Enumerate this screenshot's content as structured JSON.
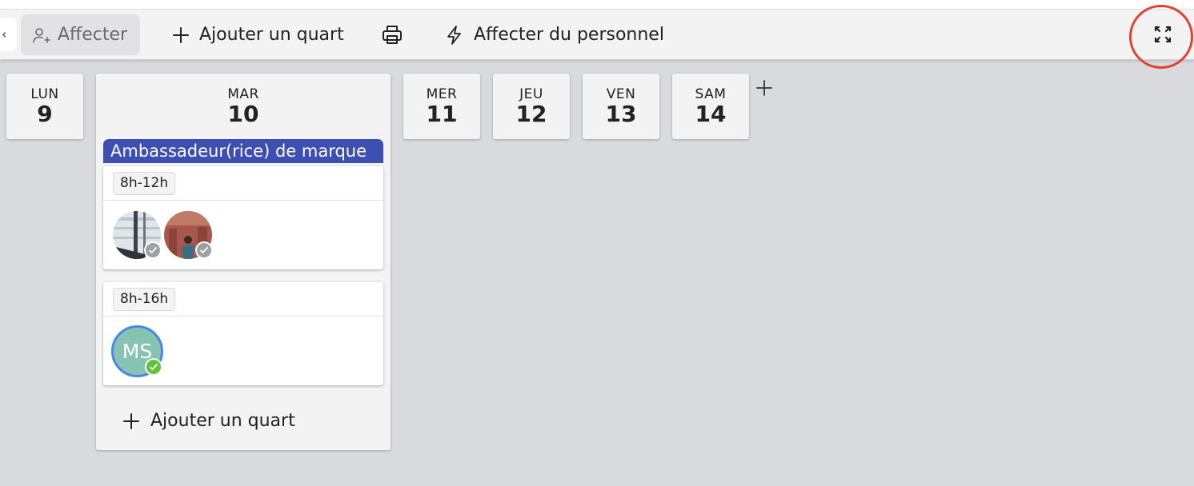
{
  "toolbar": {
    "partial_left_glyph": "‹",
    "affecter_label": "Affecter",
    "add_shift_label": "Ajouter un quart",
    "assign_staff_label": "Affecter du personnel"
  },
  "days": [
    {
      "name": "LUN",
      "num": "9"
    },
    {
      "name": "MAR",
      "num": "10"
    },
    {
      "name": "MER",
      "num": "11"
    },
    {
      "name": "JEU",
      "num": "12"
    },
    {
      "name": "VEN",
      "num": "13"
    },
    {
      "name": "SAM",
      "num": "14"
    }
  ],
  "tuesday": {
    "role": "Ambassadeur(rice) de marque",
    "shifts": [
      {
        "time": "8h-12h"
      },
      {
        "time": "8h-16h",
        "avatar_initials": "MS"
      }
    ],
    "add_shift_label": "Ajouter un quart"
  },
  "colors": {
    "role_bar": "#3e4fb3",
    "check_confirmed": "#5fc43a",
    "check_pending": "#9ea0a4",
    "ms_avatar": "#87c3b1",
    "highlight_circle": "#e2412e"
  },
  "icons": [
    "user-assign-icon",
    "plus-icon",
    "print-icon",
    "lightning-icon",
    "expand-icon",
    "check-icon"
  ]
}
